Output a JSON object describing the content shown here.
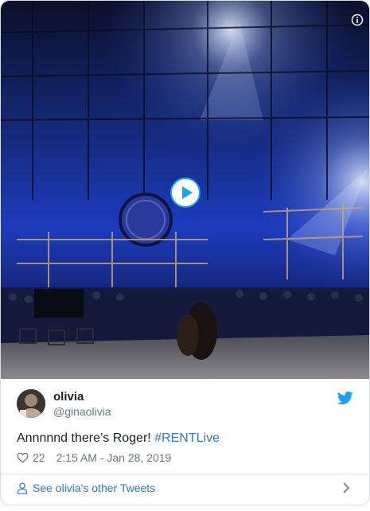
{
  "tweet": {
    "display_name": "olivia",
    "handle": "@ginaolivia",
    "text_prefix": "Annnnnd there’s Roger! ",
    "hashtag": "#RENTLive",
    "likes": "22",
    "timestamp": "2:15 AM - Jan 28, 2019"
  },
  "footer": {
    "link_label": "See olivia's other Tweets"
  },
  "media": {
    "type": "video",
    "icons": [
      "play-icon",
      "info-icon"
    ]
  },
  "colors": {
    "link": "#2b7bb9",
    "twitter_blue": "#1da1f2",
    "muted_text": "#697882",
    "stage_blue": "#1b2fb8"
  }
}
